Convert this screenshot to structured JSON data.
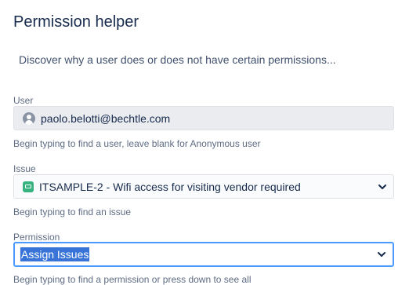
{
  "header": {
    "title": "Permission helper",
    "description": "Discover why a user does or does not have certain permissions..."
  },
  "form": {
    "user": {
      "label": "User",
      "value": "paolo.belotti@bechtle.com",
      "help": "Begin typing to find a user, leave blank for Anonymous user",
      "icon": "user-avatar-icon"
    },
    "issue": {
      "label": "Issue",
      "value": "ITSAMPLE-2 - Wifi access for visiting vendor required",
      "help": "Begin typing to find an issue",
      "icon": "issue-type-icon"
    },
    "permission": {
      "label": "Permission",
      "value": "Assign Issues",
      "help": "Begin typing to find a permission or press down to see all"
    }
  },
  "colors": {
    "accent_focus": "#4c9aff",
    "selection": "#3874d8",
    "issue_icon": "#36b37e",
    "text": "#172b4d",
    "muted": "#5e6c84"
  }
}
